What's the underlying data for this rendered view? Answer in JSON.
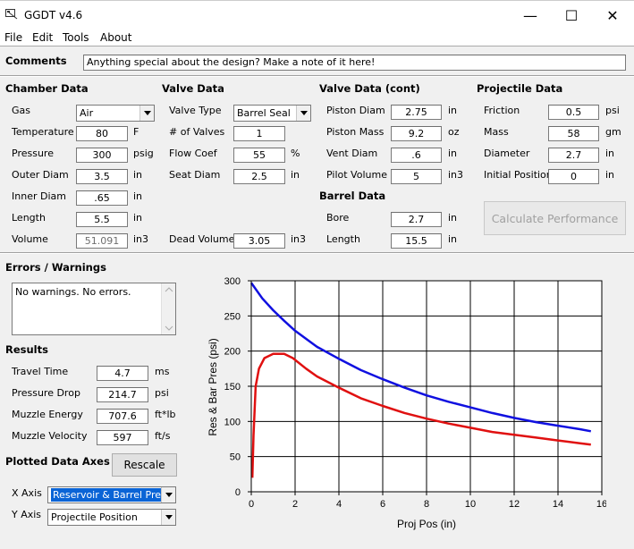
{
  "window": {
    "title": "GGDT v4.6",
    "minimize": "—",
    "maximize": "☐",
    "close": "✕"
  },
  "menu": [
    "File",
    "Edit",
    "Tools",
    "About"
  ],
  "comments": {
    "label": "Comments",
    "value": "Anything special about the design?  Make a note of it here!"
  },
  "chamber": {
    "heading": "Chamber Data",
    "gas_label": "Gas",
    "gas_value": "Air",
    "temperature_label": "Temperature",
    "temperature_value": "80",
    "temperature_unit": "F",
    "pressure_label": "Pressure",
    "pressure_value": "300",
    "pressure_unit": "psig",
    "outer_diam_label": "Outer Diam",
    "outer_diam_value": "3.5",
    "outer_diam_unit": "in",
    "inner_diam_label": "Inner Diam",
    "inner_diam_value": ".65",
    "inner_diam_unit": "in",
    "length_label": "Length",
    "length_value": "5.5",
    "length_unit": "in",
    "volume_label": "Volume",
    "volume_value": "51.091",
    "volume_unit": "in3"
  },
  "valve": {
    "heading": "Valve Data",
    "type_label": "Valve Type",
    "type_value": "Barrel Seal",
    "num_valves_label": "# of Valves",
    "num_valves_value": "1",
    "flow_coef_label": "Flow Coef",
    "flow_coef_value": "55",
    "flow_coef_unit": "%",
    "seat_diam_label": "Seat Diam",
    "seat_diam_value": "2.5",
    "seat_diam_unit": "in",
    "dead_volume_label": "Dead Volume",
    "dead_volume_value": "3.05",
    "dead_volume_unit": "in3"
  },
  "valve_cont": {
    "heading": "Valve Data (cont)",
    "piston_diam_label": "Piston Diam",
    "piston_diam_value": "2.75",
    "piston_diam_unit": "in",
    "piston_mass_label": "Piston Mass",
    "piston_mass_value": "9.2",
    "piston_mass_unit": "oz",
    "vent_diam_label": "Vent Diam",
    "vent_diam_value": ".6",
    "vent_diam_unit": "in",
    "pilot_volume_label": "Pilot Volume",
    "pilot_volume_value": "5",
    "pilot_volume_unit": "in3"
  },
  "barrel": {
    "heading": "Barrel Data",
    "bore_label": "Bore",
    "bore_value": "2.7",
    "bore_unit": "in",
    "length_label": "Length",
    "length_value": "15.5",
    "length_unit": "in"
  },
  "projectile": {
    "heading": "Projectile Data",
    "friction_label": "Friction",
    "friction_value": "0.5",
    "friction_unit": "psi",
    "mass_label": "Mass",
    "mass_value": "58",
    "mass_unit": "gm",
    "diameter_label": "Diameter",
    "diameter_value": "2.7",
    "diameter_unit": "in",
    "initial_position_label": "Initial Position",
    "initial_position_value": "0",
    "initial_position_unit": "in"
  },
  "calculate_button": "Calculate Performance",
  "errors": {
    "heading": "Errors / Warnings",
    "text": "No warnings.  No errors."
  },
  "results": {
    "heading": "Results",
    "travel_time_label": "Travel Time",
    "travel_time_value": "4.7",
    "travel_time_unit": "ms",
    "pressure_drop_label": "Pressure Drop",
    "pressure_drop_value": "214.7",
    "pressure_drop_unit": "psi",
    "muzzle_energy_label": "Muzzle Energy",
    "muzzle_energy_value": "707.6",
    "muzzle_energy_unit": "ft*lb",
    "muzzle_velocity_label": "Muzzle Velocity",
    "muzzle_velocity_value": "597",
    "muzzle_velocity_unit": "ft/s"
  },
  "axes": {
    "heading": "Plotted Data Axes",
    "rescale_button": "Rescale",
    "x_axis_label": "X Axis",
    "x_axis_value": "Reservoir & Barrel Pressu",
    "y_axis_label": "Y Axis",
    "y_axis_value": "Projectile Position"
  },
  "colors": {
    "reservoir": "#1010e0",
    "barrel": "#e01010",
    "accent": "#0a64d6"
  },
  "chart_data": {
    "type": "line",
    "xlabel": "Proj Pos (in)",
    "ylabel": "Res & Bar Pres (psi)",
    "xlim": [
      0,
      16
    ],
    "ylim": [
      0,
      300
    ],
    "xticks": [
      0,
      2,
      4,
      6,
      8,
      10,
      12,
      14,
      16
    ],
    "yticks": [
      0,
      50,
      100,
      150,
      200,
      250,
      300
    ],
    "grid": true,
    "series": [
      {
        "color": "#1010e0",
        "x": [
          0,
          0.5,
          1,
          1.5,
          2,
          3,
          4,
          5,
          6,
          7,
          8,
          9,
          10,
          11,
          12,
          13,
          14,
          15,
          15.5
        ],
        "y": [
          297,
          275,
          258,
          243,
          229,
          206,
          189,
          173,
          160,
          148,
          137,
          128,
          120,
          112,
          105,
          99,
          94,
          89,
          86
        ]
      },
      {
        "color": "#e01010",
        "x": [
          0.05,
          0.1,
          0.2,
          0.35,
          0.6,
          1,
          1.5,
          1.9,
          2.5,
          3,
          4,
          5,
          6,
          7,
          8,
          9,
          10,
          11,
          12,
          13,
          14,
          15,
          15.5
        ],
        "y": [
          20,
          80,
          150,
          175,
          190,
          196,
          196,
          190,
          175,
          164,
          148,
          133,
          122,
          112,
          104,
          97,
          91,
          85,
          81,
          77,
          73,
          69,
          67
        ]
      }
    ]
  }
}
